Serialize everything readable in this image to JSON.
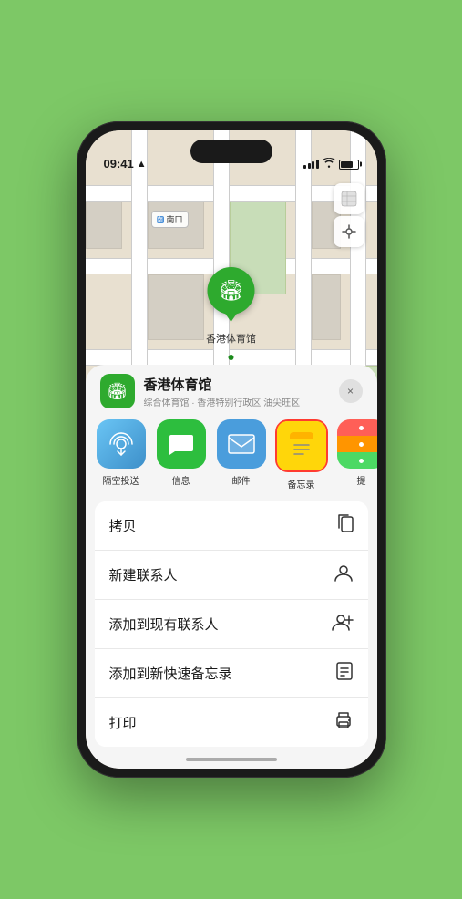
{
  "statusBar": {
    "time": "09:41",
    "locationArrow": "▲"
  },
  "map": {
    "labelText": "南口",
    "pinLabel": "香港体育馆"
  },
  "mapButtons": [
    {
      "icon": "🗺",
      "name": "map-type-button"
    },
    {
      "icon": "➤",
      "name": "location-button"
    }
  ],
  "placeCard": {
    "name": "香港体育馆",
    "description": "综合体育馆 · 香港特别行政区 油尖旺区",
    "closeLabel": "×"
  },
  "shareItems": [
    {
      "id": "airdrop",
      "label": "隔空投送",
      "icon": "📡"
    },
    {
      "id": "message",
      "label": "信息",
      "icon": "💬"
    },
    {
      "id": "mail",
      "label": "邮件",
      "icon": "✉"
    },
    {
      "id": "notes",
      "label": "备忘录",
      "icon": "📝",
      "selected": true
    },
    {
      "id": "more",
      "label": "提",
      "icon": "···"
    }
  ],
  "actions": [
    {
      "label": "拷贝",
      "icon": "copy"
    },
    {
      "label": "新建联系人",
      "icon": "person"
    },
    {
      "label": "添加到现有联系人",
      "icon": "person-add"
    },
    {
      "label": "添加到新快速备忘录",
      "icon": "note"
    },
    {
      "label": "打印",
      "icon": "print"
    }
  ]
}
